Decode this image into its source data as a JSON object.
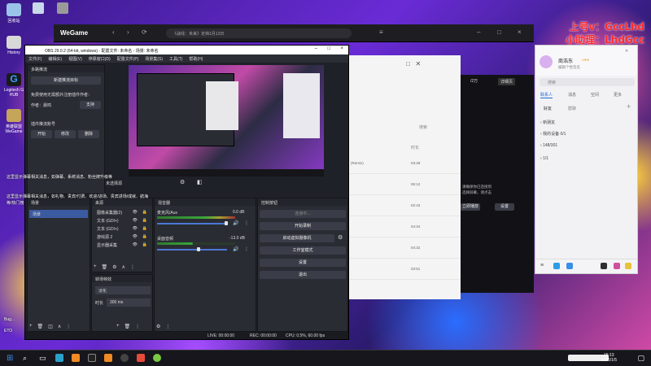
{
  "desktop": {
    "icons": [
      {
        "label": "回收站",
        "color": "#9bc3ea"
      },
      {
        "label": "History",
        "color": "#d8d8d8"
      },
      {
        "label": "Logitech G HUB",
        "color": "#1a1a1a"
      },
      {
        "label": "英雄联盟WeGame",
        "color": "#c5a55a"
      }
    ],
    "watermark": {
      "line1": "上号v：GccLhd",
      "line2": "小助理：LhdGcc"
    },
    "captions": [
      "这里显示弹幕相关消息，如弹幕、系统消息、粉丝牌升级等",
      "这里显示弹幕相关消息，如礼物、贵宾/付费、欢迎/进场、贵宾进场/成就、航海",
      "等/热门榜",
      "Bug...",
      "ETO"
    ]
  },
  "browser": {
    "logo": "WeGame",
    "address": "《战线：未来》定档1月13日"
  },
  "music_window": {
    "badge": "/2万",
    "tab": "详细页",
    "search_label": "搜索",
    "col_time": "时长",
    "rows": [
      {
        "title": "(Remix)",
        "time": "03:48"
      },
      {
        "title": "",
        "time": "06:12"
      },
      {
        "title": "",
        "time": "02:43"
      },
      {
        "title": "",
        "time": "04:34"
      },
      {
        "title": "",
        "time": "04:32"
      },
      {
        "title": "",
        "time": "03:51"
      }
    ]
  },
  "game_client": {
    "hint_line1": "请确保你已连接到",
    "hint_line2": "选择屏幕，请点击",
    "btn_a": "立即播放",
    "btn_b": "设置"
  },
  "obs": {
    "title": "OBS 29.0.2 (64-bit, windows) - 配置文件: 未命名 - 场景: 未命名",
    "menu": [
      "文件(F)",
      "编辑(E)",
      "视图(V)",
      "停靠窗口(D)",
      "配置文件(P)",
      "场景集(S)",
      "工具(T)",
      "帮助(H)"
    ],
    "plugin": {
      "title": "多路推流",
      "new_target": "新建推流目标",
      "notice": "免费使用无需额外注册插件作者：",
      "author_label": "作者：晨鸣",
      "support": "支持"
    },
    "stats_label": "插件推流账号",
    "stats_btns": [
      "开始",
      "修改",
      "删除"
    ],
    "unnamed_scene": "未选择源",
    "docks": {
      "scenes": {
        "title": "场景",
        "items": [
          "场景"
        ]
      },
      "sources": {
        "title": "来源",
        "items": [
          {
            "label": "图像采集器(2)"
          },
          {
            "label": "文本 (GDI+)"
          },
          {
            "label": "文本 (GDI+)"
          },
          {
            "label": "游戏源 2"
          },
          {
            "label": "显示器采集"
          }
        ]
      },
      "mixer": {
        "title": "混音器",
        "channels": [
          {
            "name": "麦克风/Aux",
            "db": "0.0 dB"
          },
          {
            "name": "桌面音频",
            "db": "-13.0 dB"
          }
        ]
      },
      "controls": {
        "title": "控制按钮",
        "buttons": [
          "连接中...",
          "开始录制",
          "启动虚拟摄像机",
          "工作室模式",
          "设置",
          "退出"
        ]
      },
      "transitions": {
        "title": "转场特效",
        "type": "淡化",
        "duration_label": "时长",
        "duration": "300 ms"
      }
    },
    "status": {
      "live": "LIVE: 00:00:00",
      "rec": "REC: 00:00:00",
      "cpu": "CPU: 0.5%, 60.00 fps"
    }
  },
  "chat": {
    "username": "商浩东",
    "badge": "VIP8",
    "status": "编辑个性签名",
    "search": "搜索",
    "tabs": [
      "联系人",
      "消息",
      "空间",
      "更多"
    ],
    "sections": [
      "好友",
      "群聊"
    ],
    "groups": [
      "新朋友",
      "我的设备 0/1",
      "148/301",
      "1/1"
    ]
  },
  "taskbar": {
    "time": "15:13",
    "date": "2026/1/5"
  }
}
